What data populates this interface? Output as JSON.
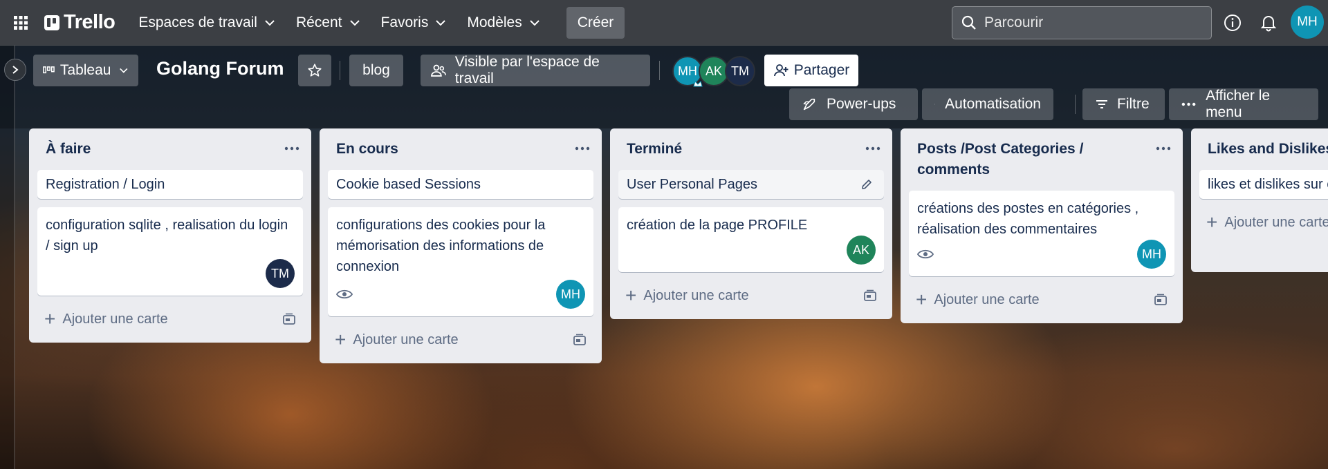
{
  "nav": {
    "logo_text": "Trello",
    "menu": [
      {
        "label": "Espaces de travail"
      },
      {
        "label": "Récent"
      },
      {
        "label": "Favoris"
      },
      {
        "label": "Modèles"
      }
    ],
    "create_label": "Créer",
    "search_placeholder": "Parcourir",
    "user_initials": "MH"
  },
  "board": {
    "view_label": "Tableau",
    "title": "Golang Forum",
    "tag": "blog",
    "visibility": "Visible par l'espace de travail",
    "members": [
      {
        "initials": "MH",
        "color": "#0f95b4"
      },
      {
        "initials": "AK",
        "color": "#1f845a"
      },
      {
        "initials": "TM",
        "color": "#1c2b4a"
      }
    ],
    "share_label": "Partager",
    "powerups_label": "Power-ups",
    "automation_label": "Automatisation",
    "filter_label": "Filtre",
    "menu_label": "Afficher le menu"
  },
  "lists": [
    {
      "title": "À faire",
      "cards": [
        {
          "text": "Registration / Login"
        },
        {
          "text": "configuration sqlite , realisation du login / sign up",
          "member": "TM",
          "member_color": "#1c2b4a"
        }
      ],
      "add_label": "Ajouter une carte"
    },
    {
      "title": "En cours",
      "cards": [
        {
          "text": "Cookie based Sessions"
        },
        {
          "text": "configurations des cookies pour la mémorisation des informations de connexion",
          "watch": true,
          "member": "MH",
          "member_color": "#0f95b4"
        }
      ],
      "add_label": "Ajouter une carte"
    },
    {
      "title": "Terminé",
      "cards": [
        {
          "text": "User Personal Pages"
        },
        {
          "text": "création de la page PROFILE",
          "member": "AK",
          "member_color": "#1f845a"
        }
      ],
      "add_label": "Ajouter une carte"
    },
    {
      "title": "Posts /Post Categories / comments",
      "cards": [
        {
          "text": "créations des postes en catégories , réalisation des commentaires",
          "watch": true,
          "member": "MH",
          "member_color": "#0f95b4"
        }
      ],
      "add_label": "Ajouter une carte"
    },
    {
      "title": "Likes and Dislikes",
      "cards": [
        {
          "text": "likes et dislikes sur commentaires"
        }
      ],
      "add_label": "Ajouter une carte"
    }
  ]
}
